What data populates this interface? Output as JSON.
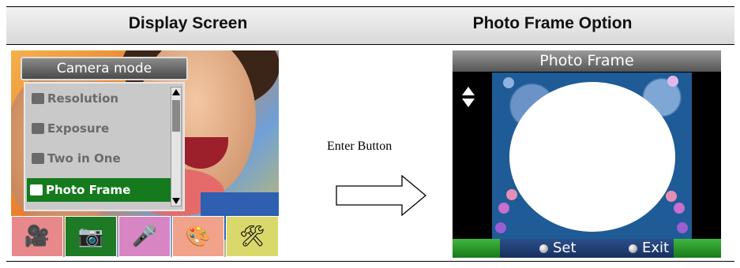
{
  "table": {
    "col_left_header": "Display Screen",
    "col_right_header": "Photo Frame Option"
  },
  "left_screen": {
    "menu_title": "Camera mode",
    "menu_items": [
      {
        "label": "Resolution",
        "icon": "resolution-icon",
        "selected": false
      },
      {
        "label": "Exposure",
        "icon": "exposure-icon",
        "selected": false
      },
      {
        "label": "Two in One",
        "icon": "two-in-one-icon",
        "selected": false
      },
      {
        "label": "Photo Frame",
        "icon": "photo-frame-icon",
        "selected": true
      }
    ],
    "tabs": [
      {
        "icon": "camcorder-icon",
        "glyph": "🎥",
        "active": false
      },
      {
        "icon": "camera-icon",
        "glyph": "📷",
        "active": true
      },
      {
        "icon": "microphone-icon",
        "glyph": "🎤",
        "active": false
      },
      {
        "icon": "palette-icon",
        "glyph": "🎨",
        "active": false
      },
      {
        "icon": "tools-icon",
        "glyph": "🛠",
        "active": false
      }
    ]
  },
  "arrow_label": "Enter Button",
  "right_screen": {
    "title": "Photo Frame",
    "set_label": "Set",
    "exit_label": "Exit"
  },
  "colors": {
    "selected_green": "#157a1d",
    "frame_blue": "#1f5b96",
    "bar_green": "#3fb53f"
  }
}
